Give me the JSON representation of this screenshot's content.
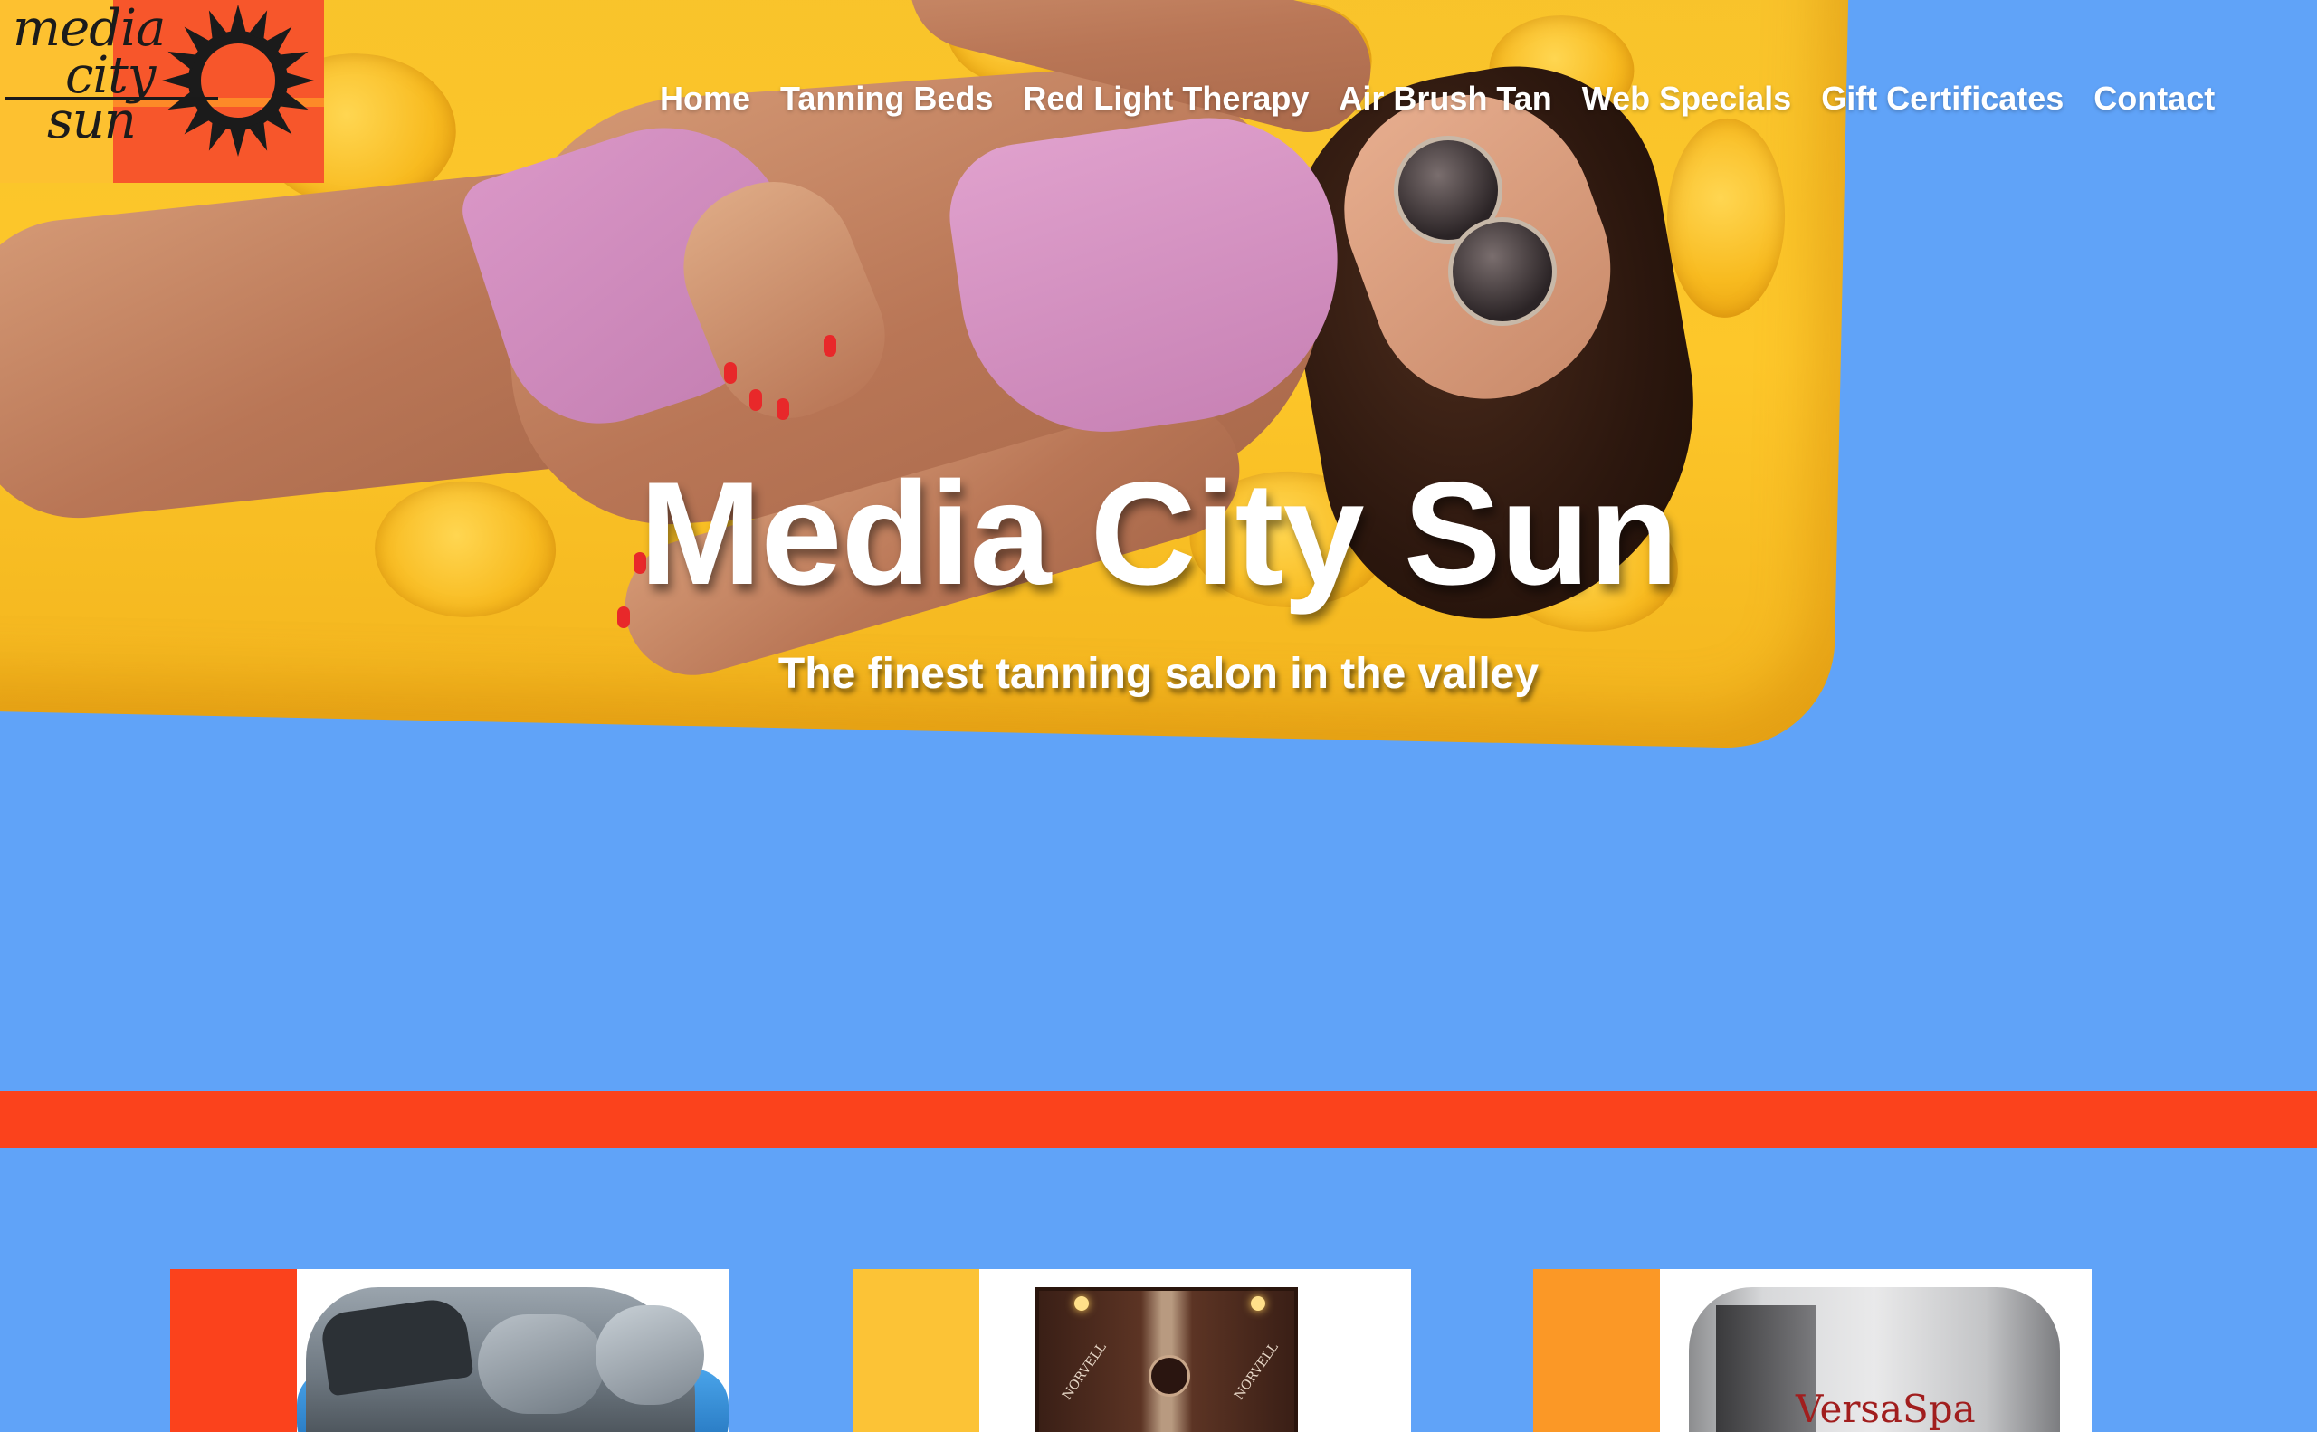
{
  "brand": {
    "logo_line1": "media",
    "logo_line2": "city",
    "logo_line3": "sun",
    "colors": {
      "yellow": "#fdc130",
      "orange_red": "#f7562b",
      "orange": "#fd8a28",
      "sky_blue": "#60a3f8",
      "stripe_red": "#fb421c"
    }
  },
  "nav": {
    "items": [
      {
        "label": "Home"
      },
      {
        "label": "Tanning Beds"
      },
      {
        "label": "Red Light Therapy"
      },
      {
        "label": "Air Brush Tan"
      },
      {
        "label": "Web Specials"
      },
      {
        "label": "Gift Certificates"
      },
      {
        "label": "Contact"
      }
    ]
  },
  "hero": {
    "title": "Media City Sun",
    "subtitle": "The finest tanning salon in the valley",
    "image_icon": "woman-on-pool-float-photo"
  },
  "cards": [
    {
      "accent": "#fb421c",
      "image_icon": "standup-tanning-unit-photo"
    },
    {
      "accent": "#fcc336",
      "image_icon": "norvell-spray-booth-photo",
      "brand_text": "NORVELL"
    },
    {
      "accent": "#fb9826",
      "image_icon": "versaspa-booth-photo",
      "brand_text": "VersaSpa"
    }
  ]
}
